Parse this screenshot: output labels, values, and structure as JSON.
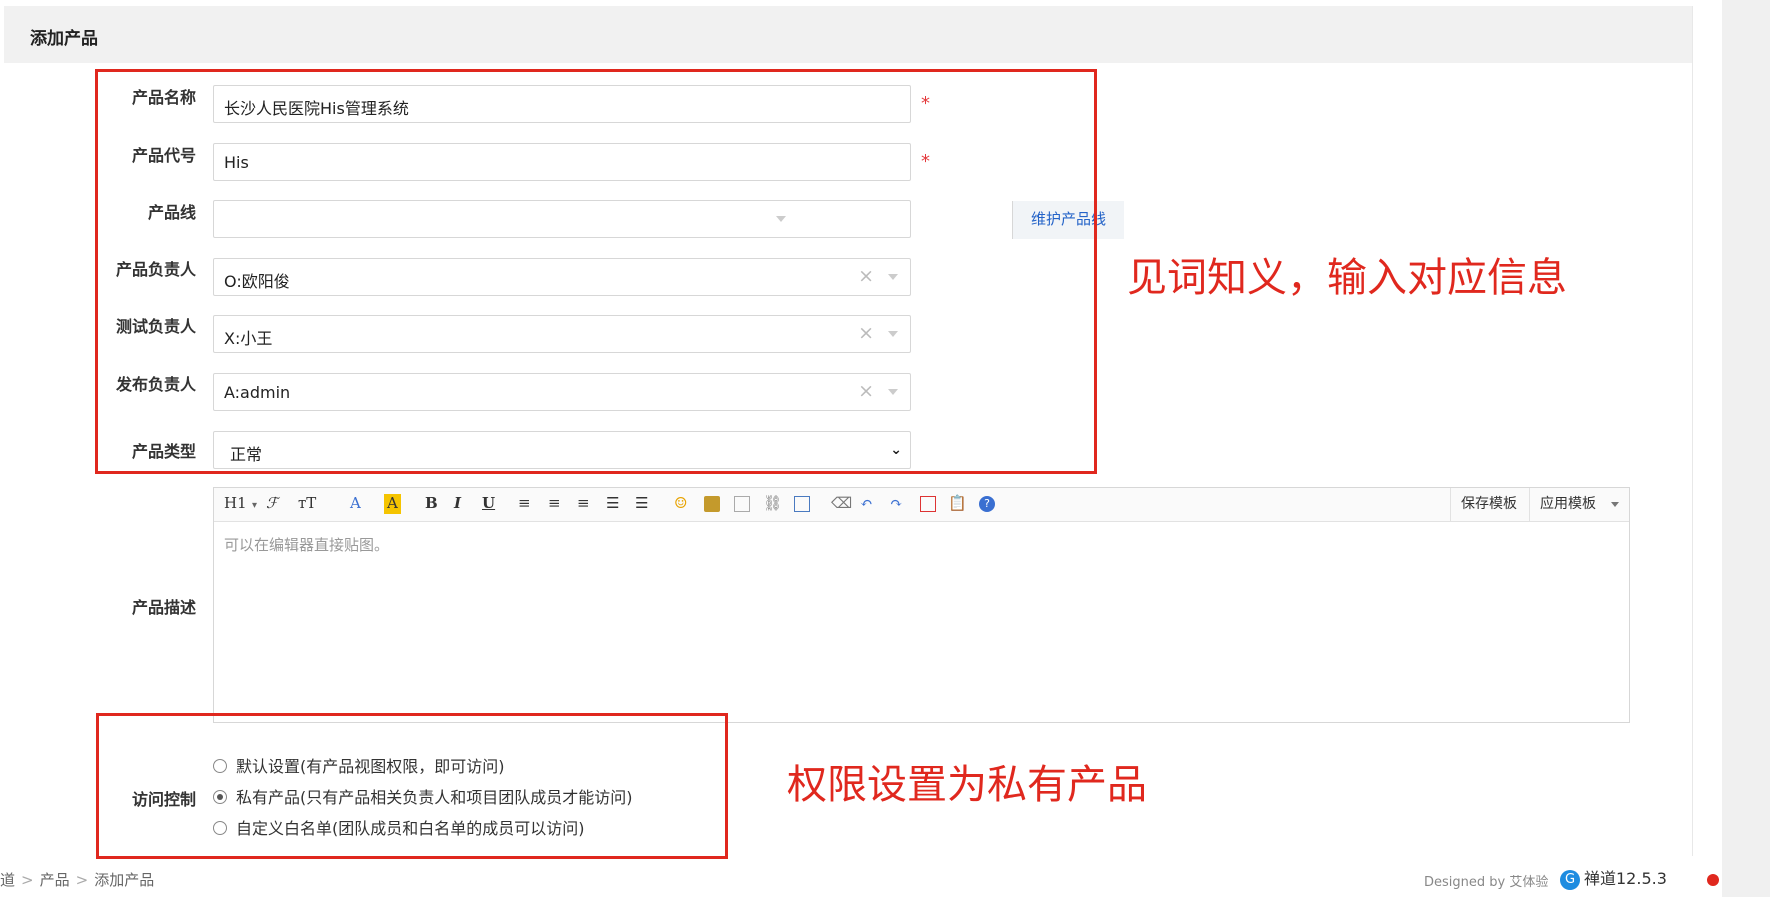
{
  "panel": {
    "title": "添加产品"
  },
  "form": {
    "name": {
      "label": "产品名称",
      "value": "长沙人民医院His管理系统",
      "required": "*"
    },
    "code": {
      "label": "产品代号",
      "value": "His",
      "required": "*"
    },
    "line": {
      "label": "产品线",
      "value": "",
      "maintain_button": "维护产品线"
    },
    "owner": {
      "label": "产品负责人",
      "value": "O:欧阳俊"
    },
    "tester": {
      "label": "测试负责人",
      "value": "X:小王"
    },
    "releaser": {
      "label": "发布负责人",
      "value": "A:admin"
    },
    "type": {
      "label": "产品类型",
      "value": "正常"
    },
    "desc": {
      "label": "产品描述",
      "placeholder": "可以在编辑器直接贴图。",
      "toolbar": {
        "h1": "H1",
        "save_template": "保存模板",
        "apply_template": "应用模板"
      }
    },
    "acl": {
      "label": "访问控制",
      "options": [
        {
          "label": "默认设置(有产品视图权限，即可访问)",
          "selected": false
        },
        {
          "label": "私有产品(只有产品相关负责人和项目团队成员才能访问)",
          "selected": true
        },
        {
          "label": "自定义白名单(团队成员和白名单的成员可以访问)",
          "selected": false
        }
      ]
    }
  },
  "annotations": {
    "top": "见词知义，输入对应信息",
    "bottom": "权限设置为私有产品",
    "color": "#e0281e"
  },
  "footer": {
    "breadcrumb": [
      "道",
      "产品",
      "添加产品"
    ],
    "designed_by": "Designed by 艾体验",
    "version": "禅道12.5.3"
  }
}
